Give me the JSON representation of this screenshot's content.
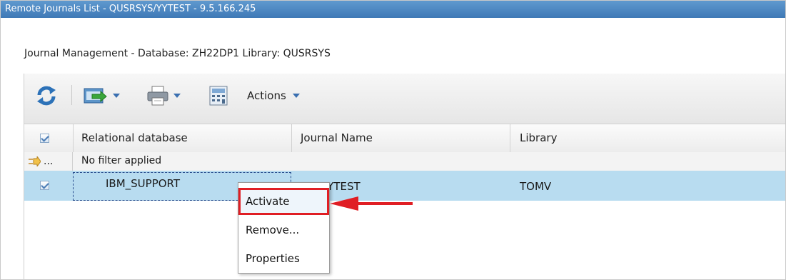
{
  "window": {
    "title": "Remote Journals List - QUSRSYS/YYTEST - 9.5.166.245"
  },
  "context": {
    "subtitle": "Journal Management - Database: ZH22DP1 Library: QUSRSYS"
  },
  "toolbar": {
    "actions_label": "Actions",
    "icons": [
      "refresh-icon",
      "export-icon",
      "print-icon",
      "calculator-icon"
    ]
  },
  "table": {
    "columns": [
      "Relational database",
      "Journal Name",
      "Library"
    ],
    "filter": {
      "button_label": "...",
      "text": "No filter applied"
    },
    "rows": [
      {
        "database": "IBM_SUPPORT",
        "journal": "YYTEST",
        "library": "TOMV",
        "selected": true
      }
    ]
  },
  "context_menu": {
    "items": [
      "Activate",
      "Remove...",
      "Properties"
    ],
    "highlighted": "Activate"
  },
  "colors": {
    "title_bar": "#4a86c2",
    "selected_row": "#b8dcf0",
    "annotation": "#e01e24"
  }
}
